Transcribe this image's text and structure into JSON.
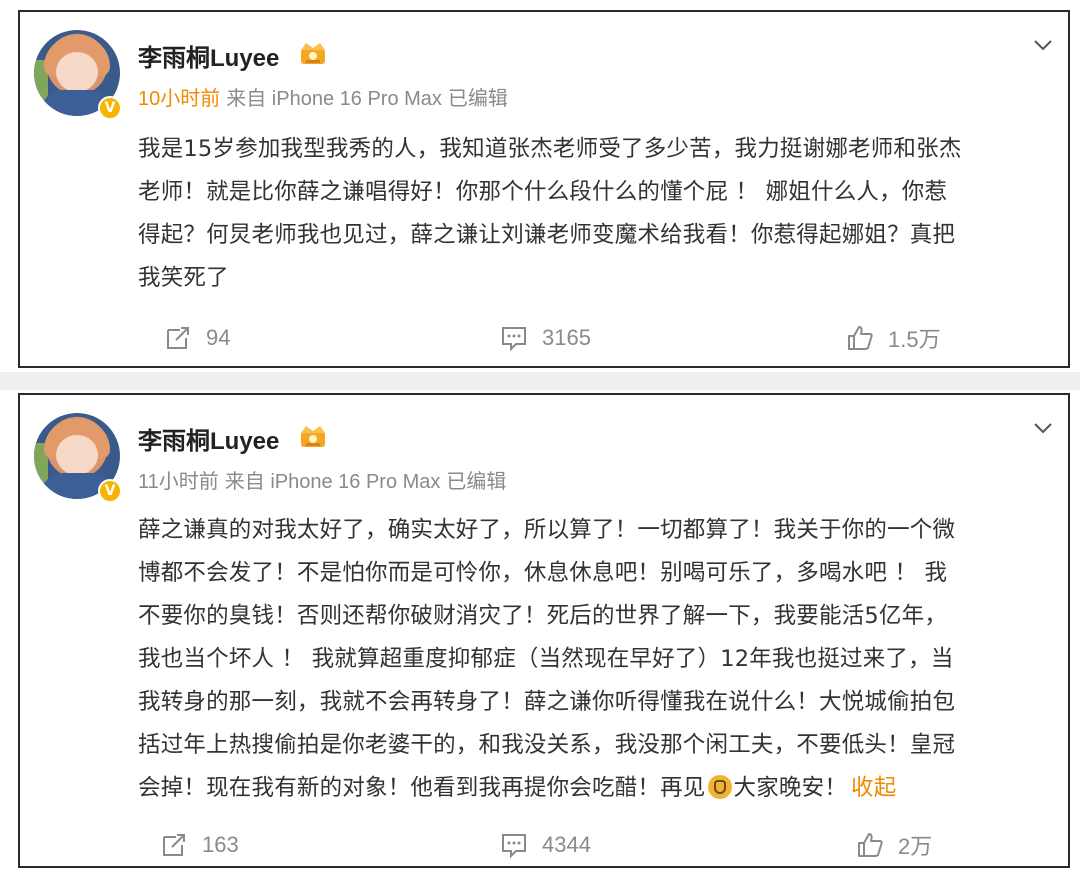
{
  "posts": [
    {
      "username": "李雨桐Luyee",
      "time": "10小时前",
      "source": "来自 iPhone 16 Pro Max",
      "edited": "已编辑",
      "text_lines": [
        "我是15岁参加我型我秀的人，我知道张杰老师受了多少苦，我力挺谢娜老师和张杰",
        "老师！就是比你薛之谦唱得好！你那个什么段什么的懂个屁 ！ 娜姐什么人，你惹",
        "得起？何炅老师我也见过，薛之谦让刘谦老师变魔术给我看！你惹得起娜姐？真把",
        "我笑死了"
      ],
      "reposts": "94",
      "comments": "3165",
      "likes": "1.5万"
    },
    {
      "username": "李雨桐Luyee",
      "time": "11小时前",
      "source": "来自 iPhone 16 Pro Max",
      "edited": "已编辑",
      "text_lines": [
        "薛之谦真的对我太好了，确实太好了，所以算了！一切都算了！我关于你的一个微",
        "博都不会发了！不是怕你而是可怜你，休息休息吧！别喝可乐了，多喝水吧 ！ 我",
        "不要你的臭钱！否则还帮你破财消灾了！死后的世界了解一下，我要能活5亿年，",
        "我也当个坏人 ！ 我就算超重度抑郁症（当然现在早好了）12年我也挺过来了，当",
        "我转身的那一刻，我就不会再转身了！薛之谦你听得懂我在说什么！大悦城偷拍包",
        "括过年上热搜偷拍是你老婆干的，和我没关系，我没那个闲工夫，不要低头！皇冠",
        "会掉！现在我有新的对象！他看到我再提你会吃醋！再见"
      ],
      "text_tail": "大家晚安！",
      "collapse_label": "收起",
      "reposts": "163",
      "comments": "4344",
      "likes": "2万"
    }
  ],
  "icons": {
    "verified": "verified-v-badge-icon",
    "crown": "crown-icon",
    "menu": "chevron-down-icon",
    "repost": "repost-icon",
    "comment": "comment-icon",
    "like": "thumbs-up-icon",
    "clap": "clap-hands-emoji-icon"
  },
  "colors": {
    "accent": "#f08a00",
    "meta_gray": "#8a8a8a",
    "text": "#333333",
    "verified": "#f7b500"
  }
}
